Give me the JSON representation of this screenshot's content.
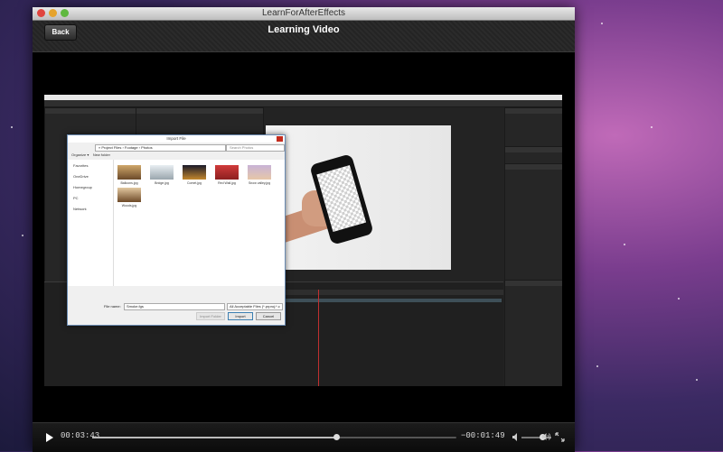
{
  "window": {
    "title": "LearnForAfterEffects"
  },
  "header": {
    "back_label": "Back",
    "title": "Learning Video"
  },
  "video_content": {
    "dialog": {
      "title": "Import File",
      "address": "« Project Files › Footage › Photos",
      "search_placeholder": "Search Photos",
      "toolbar": [
        "Organize ▾",
        "New folder"
      ],
      "sidebar": [
        "Favorites",
        "OneDrive",
        "Homegroup",
        "PC",
        "Network"
      ],
      "files": [
        "Balloons.jpg",
        "Bridge.jpg",
        "Comet.jpg",
        "Red Wall.jpg",
        "Snow valley.jpg",
        "Woods.jpg"
      ],
      "file_name_label": "File name:",
      "file_name_value": "Smoke.fgs",
      "file_type": "All Acceptable Files (*.prproj;*.c",
      "import_folder_label": "Import Folder",
      "import_label": "Import",
      "cancel_label": "Cancel"
    }
  },
  "player": {
    "elapsed": "00:03:43",
    "remaining": "−00:01:49",
    "progress": 0.67,
    "volume": 0.7
  }
}
